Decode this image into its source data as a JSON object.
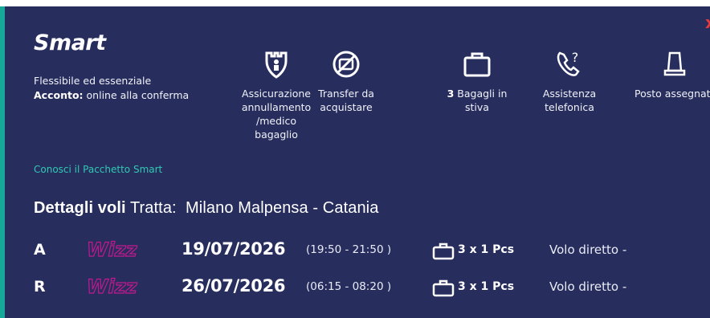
{
  "package": {
    "title": "Smart",
    "subtitle": "Flessibile ed essenziale",
    "deposit_label": "Acconto:",
    "deposit_text": "online alla conferma",
    "link": "Conosci il Pacchetto Smart",
    "close": "x"
  },
  "features": [
    {
      "icon": "shield-icon",
      "label": "Assicurazione annullamento /medico bagaglio"
    },
    {
      "icon": "no-transfer-icon",
      "label": "Transfer da acquistare"
    },
    {
      "icon": "luggage-icon",
      "count": "3",
      "label": "Bagagli in stiva"
    },
    {
      "icon": "phone-help-icon",
      "label": "Assistenza telefonica"
    },
    {
      "icon": "seat-icon",
      "label": "Posto assegnato"
    }
  ],
  "details": {
    "heading": "Dettagli voli",
    "route_label": "Tratta:",
    "route": "Milano Malpensa - Catania"
  },
  "flights": [
    {
      "dir": "A",
      "airline_logo": "Wizz",
      "date": "19/07/2026",
      "time": "(19:50 - 21:50 )",
      "baggage": "3 x 1 Pcs",
      "type": "Volo diretto -"
    },
    {
      "dir": "R",
      "airline_logo": "Wizz",
      "date": "26/07/2026",
      "time": "(06:15 - 08:20 )",
      "baggage": "3 x 1 Pcs",
      "type": "Volo diretto -"
    }
  ],
  "colors": {
    "background": "#272d5d",
    "accent": "#31c9b4",
    "close": "#e23b3b",
    "logo": "#c2188e"
  }
}
